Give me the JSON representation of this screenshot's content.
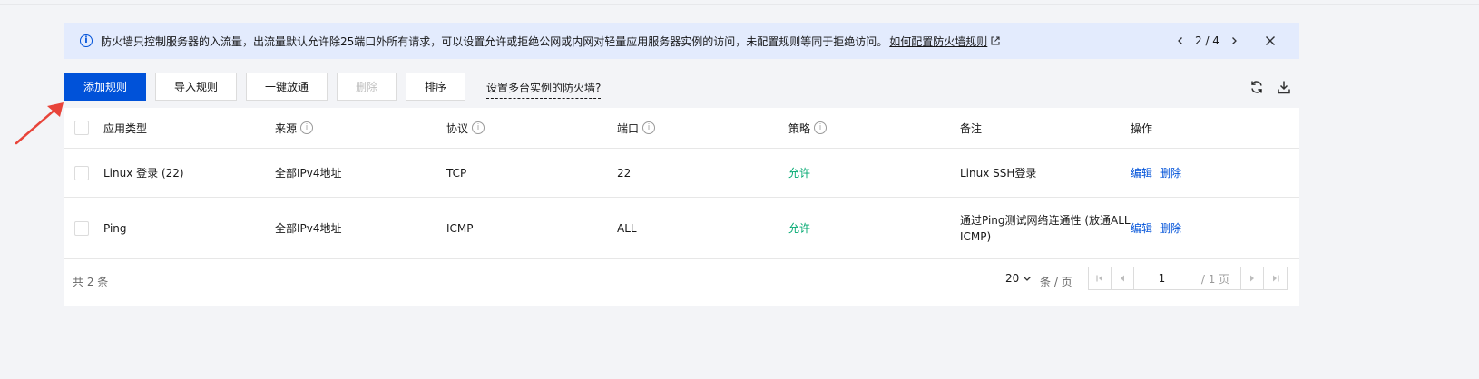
{
  "notice": {
    "message": "防火墙只控制服务器的入流量，出流量默认允许除25端口外所有请求，可以设置允许或拒绝公网或内网对轻量应用服务器实例的访问，未配置规则等同于拒绝访问。",
    "link": "如何配置防火墙规则",
    "pager": "2 / 4"
  },
  "toolbar": {
    "add_rule": "添加规则",
    "import_rule": "导入规则",
    "one_click_allow": "一键放通",
    "delete": "删除",
    "sort": "排序",
    "multi_instance_link": "设置多台实例的防火墙?"
  },
  "table": {
    "headers": {
      "app_type": "应用类型",
      "source": "来源",
      "protocol": "协议",
      "port": "端口",
      "policy": "策略",
      "remark": "备注",
      "actions": "操作"
    },
    "rows": [
      {
        "app_type": "Linux 登录 (22)",
        "source": "全部IPv4地址",
        "protocol": "TCP",
        "port": "22",
        "policy": "允许",
        "remark": "Linux SSH登录",
        "edit": "编辑",
        "delete": "删除"
      },
      {
        "app_type": "Ping",
        "source": "全部IPv4地址",
        "protocol": "ICMP",
        "port": "ALL",
        "policy": "允许",
        "remark": "通过Ping测试网络连通性 (放通ALL ICMP)",
        "edit": "编辑",
        "delete": "删除"
      }
    ]
  },
  "footer": {
    "total": "共 2 条",
    "page_size": "20",
    "per_page": "条 / 页",
    "current_page": "1",
    "total_pages": "/ 1 页"
  },
  "colors": {
    "primary": "#0052d9",
    "allow": "#00a870",
    "banner_bg": "#e3ebfd",
    "annotation": "#e8443a"
  },
  "icons": [
    "info-icon",
    "external-link-icon",
    "chevron-left-icon",
    "chevron-right-icon",
    "close-icon",
    "refresh-icon",
    "download-icon",
    "help-icon",
    "chevron-down-icon",
    "first-page-icon",
    "prev-page-icon",
    "next-page-icon",
    "last-page-icon",
    "annotation-arrow"
  ]
}
